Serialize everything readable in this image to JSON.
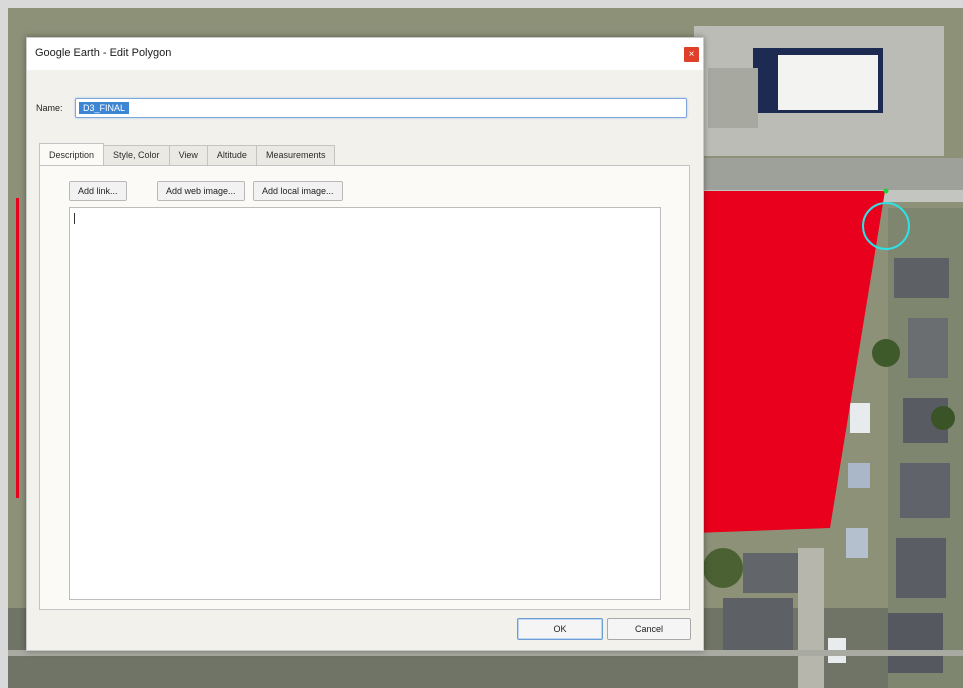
{
  "dialog": {
    "title": "Google Earth - Edit Polygon",
    "close_symbol": "×",
    "name_label": "Name:",
    "name_value": "D3_FINAL"
  },
  "tabs": [
    {
      "label": "Description",
      "active": true
    },
    {
      "label": "Style, Color",
      "active": false
    },
    {
      "label": "View",
      "active": false
    },
    {
      "label": "Altitude",
      "active": false
    },
    {
      "label": "Measurements",
      "active": false
    }
  ],
  "description_panel": {
    "add_link": "Add link...",
    "add_web_image": "Add web image...",
    "add_local_image": "Add local image...",
    "text": ""
  },
  "buttons": {
    "ok": "OK",
    "cancel": "Cancel"
  },
  "map": {
    "polygon_color": "#e8001c",
    "cursor_ring_color": "#2fe0e6",
    "vertex_color": "#1fd13c"
  }
}
